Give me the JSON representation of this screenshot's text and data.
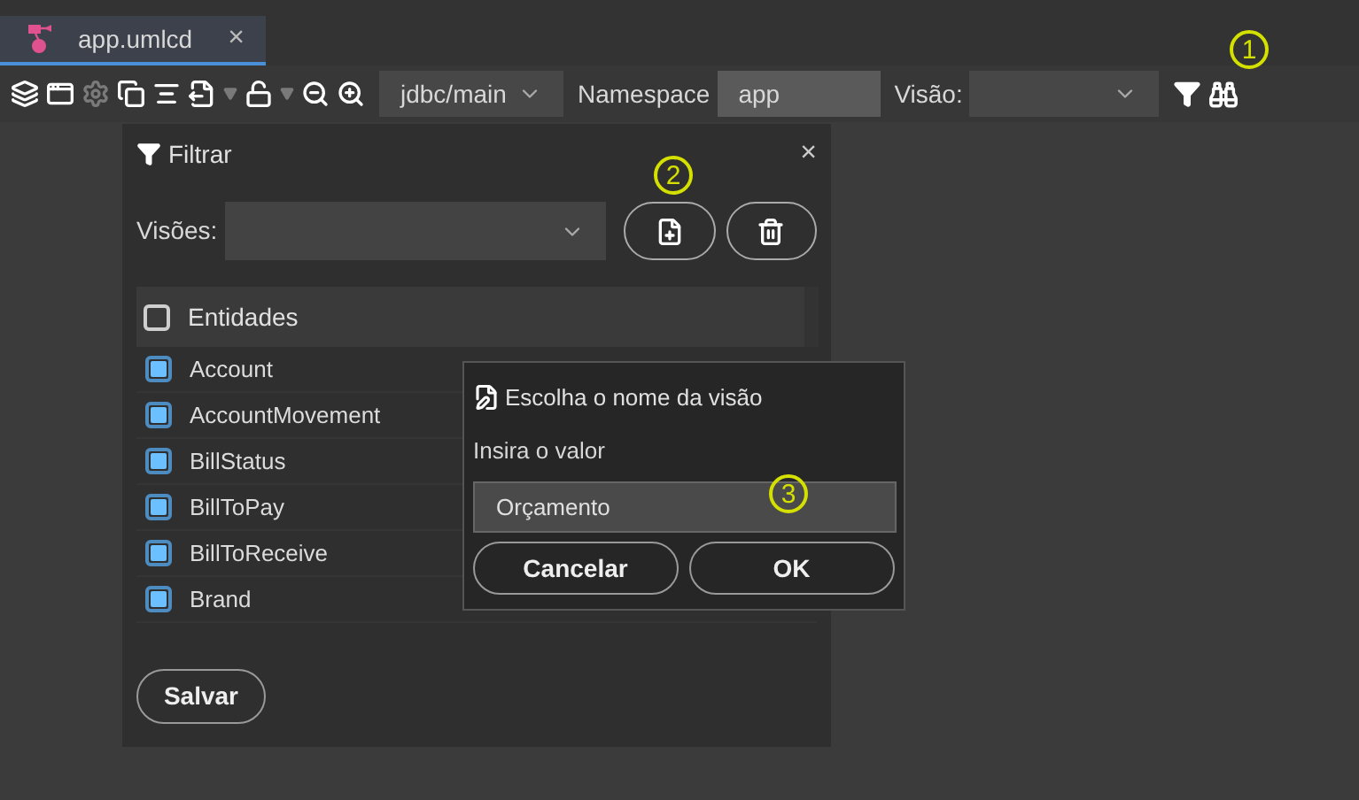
{
  "tab": {
    "title": "app.umlcd",
    "close": "×",
    "selected": true
  },
  "toolbar": {
    "buttons": [
      {
        "kind": "layers",
        "disabled": false
      },
      {
        "kind": "window",
        "disabled": false
      },
      {
        "kind": "gear",
        "disabled": true
      },
      {
        "kind": "stack",
        "disabled": false
      },
      {
        "kind": "align",
        "disabled": false
      },
      {
        "kind": "export",
        "disabled": false
      },
      {
        "kind": "caret",
        "disabled": true
      },
      {
        "kind": "unlock",
        "disabled": false
      },
      {
        "kind": "caret",
        "disabled": true
      },
      {
        "kind": "zoom-out",
        "disabled": false
      },
      {
        "kind": "zoom-in",
        "disabled": false
      }
    ],
    "branch": "jdbc/main",
    "namespace_label": "Namespace",
    "namespace_value": "app",
    "view_label": "Visão:"
  },
  "filter_panel": {
    "title": "Filtrar",
    "close": "×",
    "views_label": "Visões:",
    "header": {
      "label": "Entidades",
      "checked": false
    },
    "entities": [
      {
        "name": "Account",
        "checked": true
      },
      {
        "name": "AccountMovement",
        "checked": true
      },
      {
        "name": "BillStatus",
        "checked": true
      },
      {
        "name": "BillToPay",
        "checked": true
      },
      {
        "name": "BillToReceive",
        "checked": true
      },
      {
        "name": "Brand",
        "checked": true
      }
    ],
    "save": "Salvar"
  },
  "dialog": {
    "title": "Escolha o nome da visão",
    "prompt": "Insira o valor",
    "value": "Orçamento",
    "cancel": "Cancelar",
    "ok": "OK"
  },
  "annotations": [
    "1",
    "2",
    "3"
  ]
}
